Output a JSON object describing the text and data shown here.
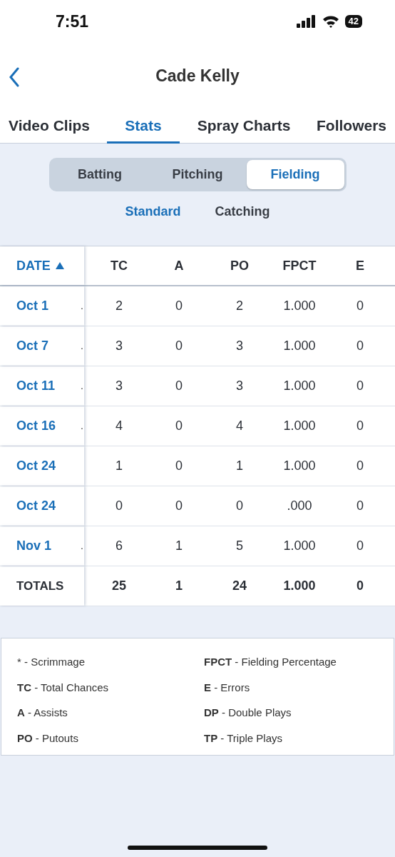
{
  "status_bar": {
    "time": "7:51",
    "battery": "42"
  },
  "header": {
    "title": "Cade Kelly"
  },
  "tabs": [
    {
      "label": "Video Clips",
      "selected": false
    },
    {
      "label": "Stats",
      "selected": true
    },
    {
      "label": "Spray Charts",
      "selected": false
    },
    {
      "label": "Followers",
      "selected": false
    }
  ],
  "segments": [
    {
      "label": "Batting",
      "selected": false
    },
    {
      "label": "Pitching",
      "selected": false
    },
    {
      "label": "Fielding",
      "selected": true
    }
  ],
  "sub_tabs": [
    {
      "label": "Standard",
      "selected": true
    },
    {
      "label": "Catching",
      "selected": false
    }
  ],
  "table": {
    "columns": [
      "DATE",
      "TC",
      "A",
      "PO",
      "FPCT",
      "E"
    ],
    "rows": [
      {
        "cells": [
          {
            "text": "Oct 1",
            "mark": "."
          },
          "2",
          "0",
          "2",
          "1.000",
          "0"
        ]
      },
      {
        "cells": [
          {
            "text": "Oct 7",
            "mark": "."
          },
          "3",
          "0",
          "3",
          "1.000",
          "0"
        ]
      },
      {
        "cells": [
          {
            "text": "Oct 11",
            "mark": "."
          },
          "3",
          "0",
          "3",
          "1.000",
          "0"
        ]
      },
      {
        "cells": [
          {
            "text": "Oct 16",
            "mark": "."
          },
          "4",
          "0",
          "4",
          "1.000",
          "0"
        ]
      },
      {
        "cells": [
          {
            "text": "Oct 24"
          },
          "1",
          "0",
          "1",
          "1.000",
          "0"
        ]
      },
      {
        "cells": [
          {
            "text": "Oct 24"
          },
          "0",
          "0",
          "0",
          ".000",
          "0"
        ]
      },
      {
        "cells": [
          {
            "text": "Nov 1",
            "mark": "."
          },
          "6",
          "1",
          "5",
          "1.000",
          "0"
        ]
      },
      {
        "kind": "totals",
        "cells": [
          {
            "text": "TOTALS"
          },
          "25",
          "1",
          "24",
          "1.000",
          "0"
        ]
      }
    ]
  },
  "legend": [
    "* - Scrimmage",
    "**FPCT** - Fielding Percentage",
    "**TC** - Total Chances",
    "**E** - Errors",
    "**A** - Assists",
    "**DP** - Double Plays",
    "**PO** - Putouts",
    "**TP** - Triple Plays"
  ]
}
